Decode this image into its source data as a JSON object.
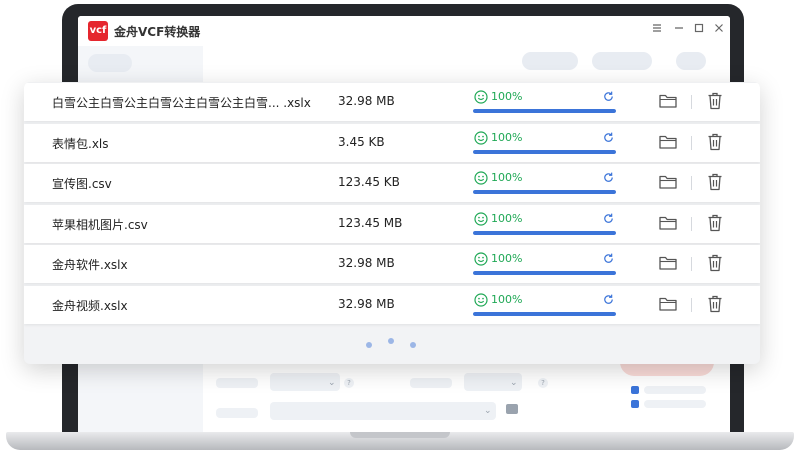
{
  "app": {
    "title": "金舟VCF转换器",
    "logo_text": "vcf",
    "window_controls": [
      "menu-icon",
      "minimize-icon",
      "maximize-icon",
      "close-icon"
    ]
  },
  "colors": {
    "accent": "#3b74d9",
    "success": "#1fa855",
    "logo_red": "#e5262e"
  },
  "files": [
    {
      "name": "白雪公主白雪公主白雪公主白雪公主白雪... .xslx",
      "size": "32.98 MB",
      "status": "100%",
      "progress": 1.0
    },
    {
      "name": "表情包.xls",
      "size": "3.45 KB",
      "status": "100%",
      "progress": 1.0
    },
    {
      "name": "宣传图.csv",
      "size": "123.45 KB",
      "status": "100%",
      "progress": 1.0
    },
    {
      "name": "苹果相机图片.csv",
      "size": "123.45 MB",
      "status": "100%",
      "progress": 1.0
    },
    {
      "name": "金舟软件.xslx",
      "size": "32.98 MB",
      "status": "100%",
      "progress": 1.0
    },
    {
      "name": "金舟视频.xslx",
      "size": "32.98 MB",
      "status": "100%",
      "progress": 1.0
    }
  ],
  "background_controls": {
    "question_mark": "?"
  }
}
